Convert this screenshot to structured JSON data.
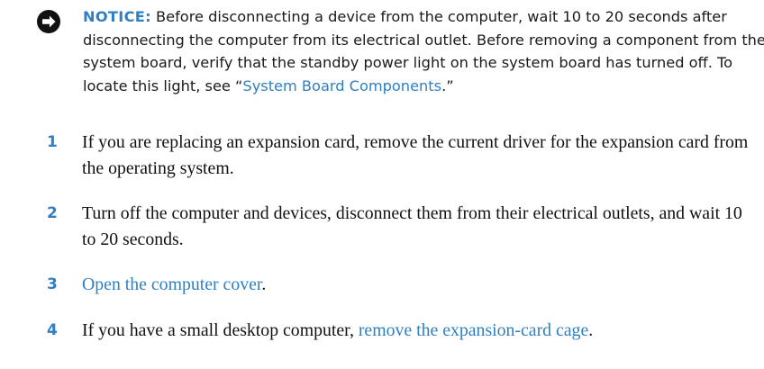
{
  "notice": {
    "icon": "notice-icon",
    "label": "NOTICE:",
    "text_before_link": " Before disconnecting a device from the computer, wait 10 to 20 seconds after disconnecting the computer from its electrical outlet. Before removing a component from the system board, verify that the standby power light on the system board has turned off. To locate this light, see “",
    "link_text": "System Board Components",
    "text_after_link": ".”"
  },
  "steps": [
    {
      "number": "1",
      "text_before_link": "If you are replacing an expansion card, remove the current driver for the expansion card from the operating system.",
      "link_text": "",
      "text_after_link": ""
    },
    {
      "number": "2",
      "text_before_link": "Turn off the computer and devices, disconnect them from their electrical outlets, and wait 10 to 20 seconds.",
      "link_text": "",
      "text_after_link": ""
    },
    {
      "number": "3",
      "text_before_link": "",
      "link_text": "Open the computer cover",
      "text_after_link": "."
    },
    {
      "number": "4",
      "text_before_link": "If you have a small desktop computer, ",
      "link_text": "remove the expansion-card cage",
      "text_after_link": "."
    }
  ],
  "colors": {
    "accent": "#2f7fc1",
    "text": "#111111",
    "icon": "#111111"
  }
}
